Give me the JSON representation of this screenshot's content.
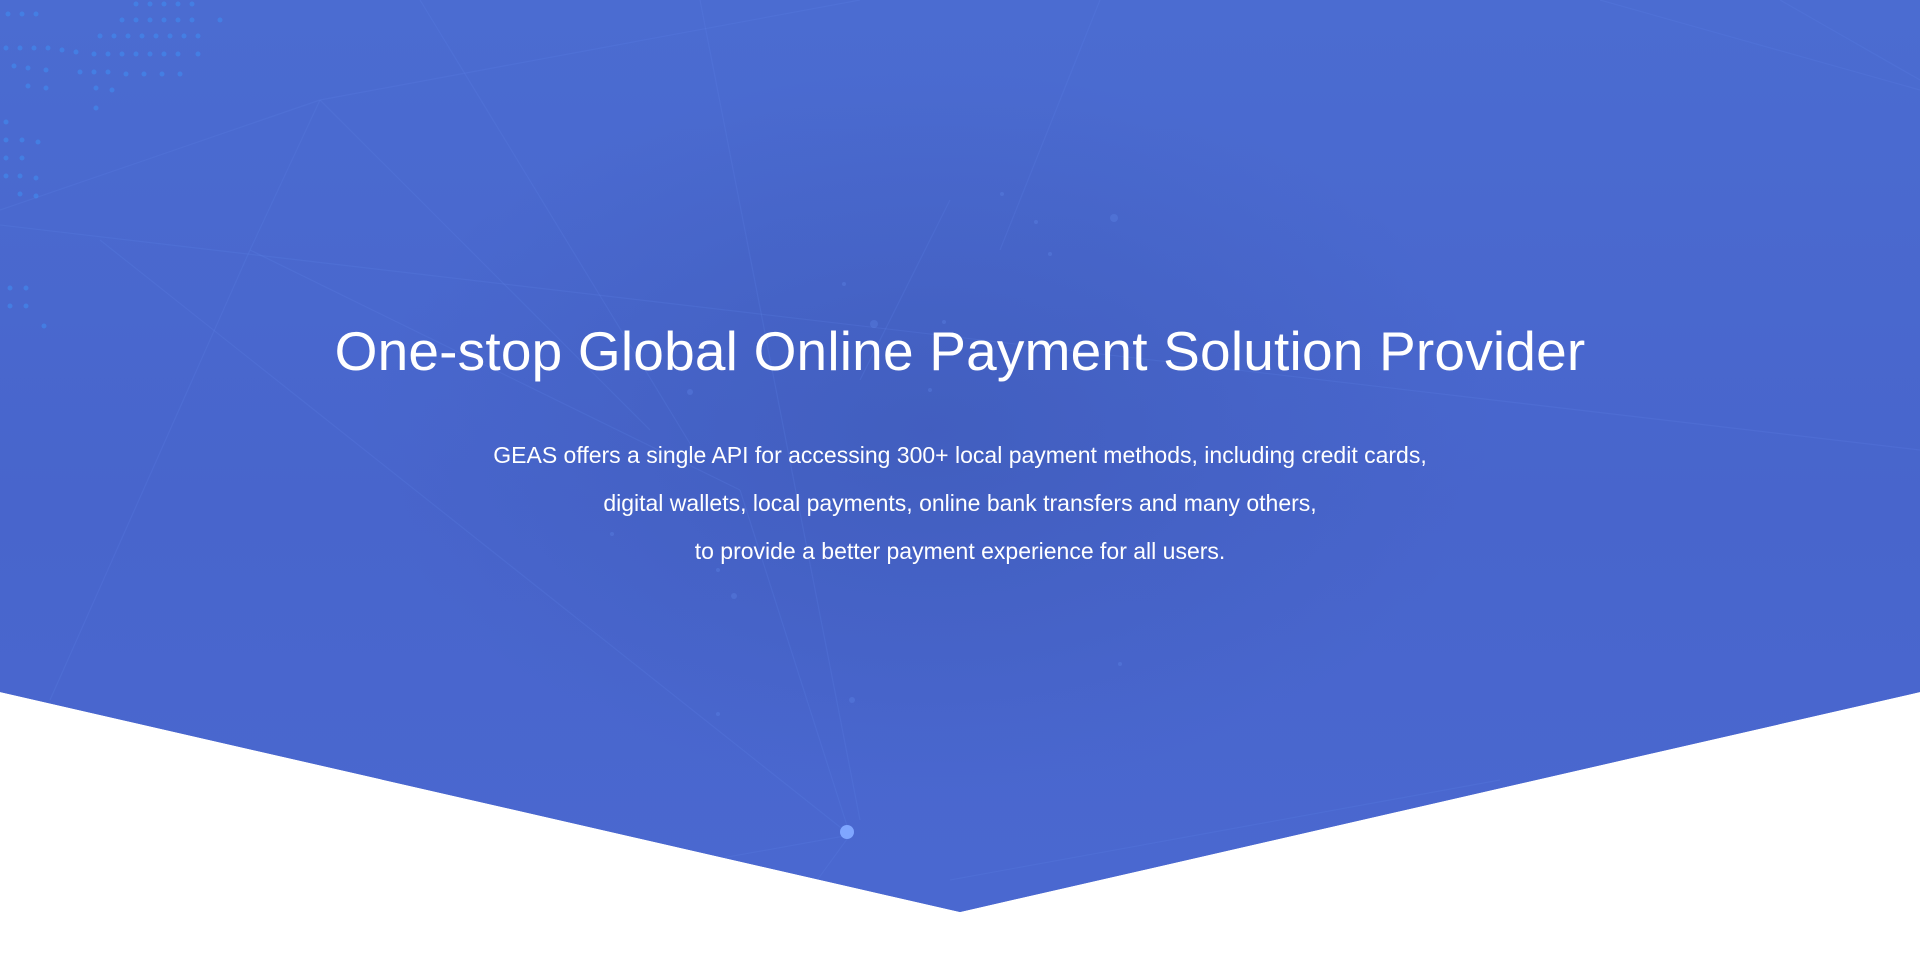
{
  "hero": {
    "title": "One-stop Global Online Payment Solution Provider",
    "description_lines": [
      "GEAS offers a single API for accessing 300+ local payment methods, including credit cards,",
      "digital wallets, local payments, online bank transfers and many others,",
      "to provide a better payment experience for all users."
    ]
  },
  "colors": {
    "hero_background": "#4966cf",
    "text": "#ffffff",
    "page_background": "#ffffff",
    "network_accent": "#7fa6ff"
  }
}
